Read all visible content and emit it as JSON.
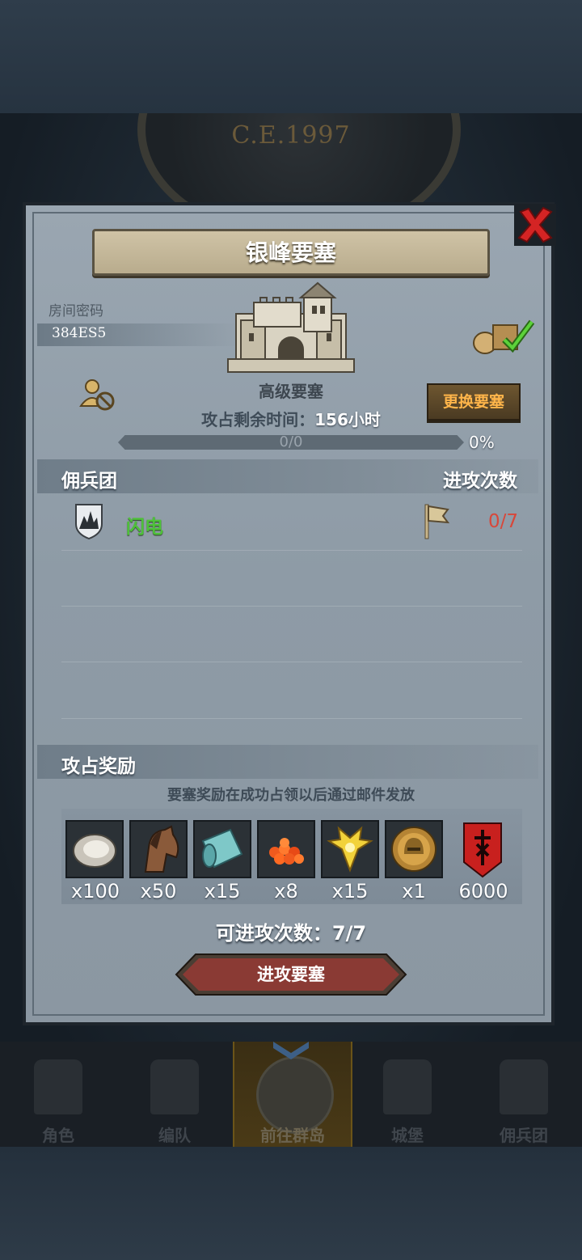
{
  "background": {
    "year_label": "C.E.1997"
  },
  "panel": {
    "title": "银峰要塞",
    "room_code_label": "房间密码",
    "room_code": "384ES5",
    "fortress_type": "高级要塞",
    "change_fortress_label": "更换要塞",
    "time_remaining_label": "攻占剩余时间：",
    "time_remaining_value": "156小时",
    "progress_text": "0/0",
    "progress_percent": "0%",
    "progress_fraction": 0,
    "guild_section_title": "佣兵团",
    "attack_count_title": "进攻次数",
    "guild_rows": [
      {
        "name": "闪电",
        "attacks": "0/7"
      }
    ],
    "rewards_section_title": "攻占奖励",
    "rewards_note": "要塞奖励在成功占领以后通过邮件发放",
    "rewards": [
      {
        "icon": "oyster-icon",
        "qty": "x100"
      },
      {
        "icon": "horse-icon",
        "qty": "x50"
      },
      {
        "icon": "cloth-roll-icon",
        "qty": "x15"
      },
      {
        "icon": "roe-icon",
        "qty": "x8"
      },
      {
        "icon": "gold-crest-icon",
        "qty": "x15"
      },
      {
        "icon": "helmet-medal-icon",
        "qty": "x1"
      },
      {
        "icon": "guild-banner-icon",
        "qty": "6000"
      }
    ],
    "available_attacks_label": "可进攻次数：",
    "available_attacks_value": "7/7",
    "attack_button_label": "进攻要塞"
  },
  "nav": {
    "items": [
      {
        "label": "角色",
        "icon": "knight-icon"
      },
      {
        "label": "编队",
        "icon": "helmet-icon"
      },
      {
        "label": "前往群岛",
        "icon": "compass-icon"
      },
      {
        "label": "城堡",
        "icon": "castle-icon"
      },
      {
        "label": "佣兵团",
        "icon": "ship-icon"
      }
    ],
    "active_index": 2
  },
  "colors": {
    "panel_bg": "#929fab",
    "guild_name": "#4ec13a",
    "attack_count": "#d8473a",
    "change_button_text": "#ffb54a",
    "attack_button": "#8a3a34"
  }
}
